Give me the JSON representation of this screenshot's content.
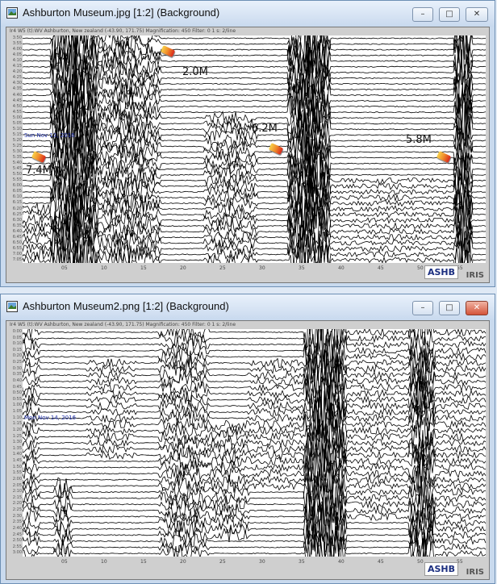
{
  "windows": [
    {
      "title": "Ashburton Museum.jpg [1:2] (Background)",
      "header": "Ir4 W5 (t):WV Ashburton, New zealand (-43.90, 171.75)    Magnification: 450    Filter: 0    1 s: 2/line",
      "date": "Sun Nov 13, 2016",
      "y_labels": [
        "3:50",
        "3:55",
        "4:00",
        "4:05",
        "4:10",
        "4:15",
        "4:20",
        "4:25",
        "4:30",
        "4:35",
        "4:40",
        "4:45",
        "4:50",
        "4:55",
        "5:00",
        "5:05",
        "5:10",
        "5:15",
        "5:20",
        "5:25",
        "5:30",
        "5:35",
        "5:40",
        "5:45",
        "5:50",
        "5:55",
        "6:00",
        "6:05",
        "6:10",
        "6:15",
        "6:20",
        "6:25",
        "6:30",
        "6:35",
        "6:40",
        "6:45",
        "6:50",
        "6:55",
        "7:00",
        "7:05"
      ],
      "x_labels": [
        "05",
        "10",
        "15",
        "20",
        "25",
        "30",
        "35",
        "40",
        "45",
        "50",
        "55"
      ],
      "magnitudes": [
        {
          "label": "7.4M"
        },
        {
          "label": "2.0M"
        },
        {
          "label": "6.2M"
        },
        {
          "label": "5.8M"
        }
      ],
      "station": "ASHB",
      "logo": "IRIS"
    },
    {
      "title": "Ashburton Museum2.png [1:2] (Background)",
      "header": "Ir4 W5 (t):WV Ashburton, New zealand (-43.90, 171.75)    Magnification: 450    Filter: 0    1 s: 2/line",
      "date": "Mon Nov 14, 2016",
      "y_labels": [
        "0:00",
        "0:05",
        "0:10",
        "0:15",
        "0:20",
        "0:25",
        "0:30",
        "0:35",
        "0:40",
        "0:45",
        "0:50",
        "0:55",
        "1:00",
        "1:05",
        "1:10",
        "1:15",
        "1:20",
        "1:25",
        "1:30",
        "1:35",
        "1:40",
        "1:45",
        "1:50",
        "1:55",
        "2:00",
        "2:05",
        "2:10",
        "2:15",
        "2:20",
        "2:25",
        "2:30",
        "2:35",
        "2:40",
        "2:45",
        "2:50",
        "2:55",
        "3:00"
      ],
      "x_labels": [
        "05",
        "10",
        "15",
        "20",
        "25",
        "30",
        "35",
        "40",
        "45",
        "50",
        "55"
      ],
      "station": "ASHB",
      "logo": "IRIS"
    }
  ],
  "controls": {
    "minimize": "–",
    "maximize": "□",
    "close": "✕"
  }
}
